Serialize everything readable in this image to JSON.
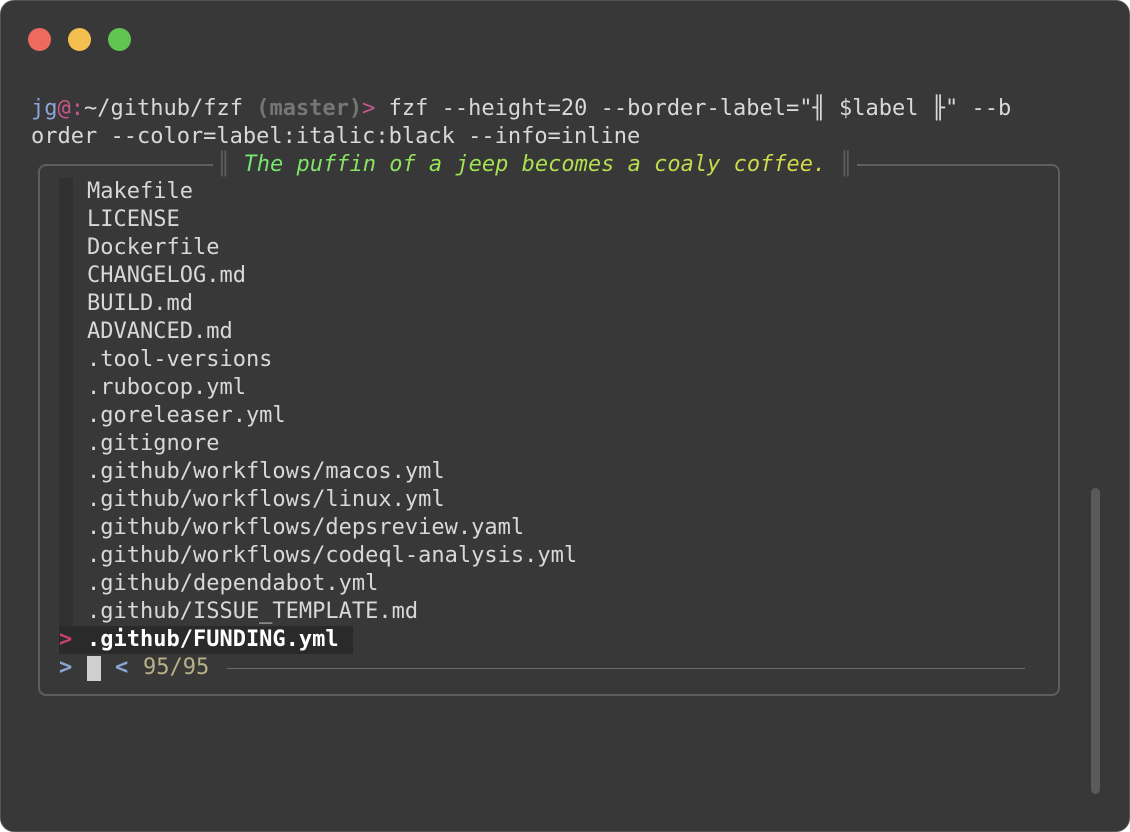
{
  "window": {
    "traffic_lights": {
      "close_color": "#ed6a5e",
      "minimize_color": "#f5bf4f",
      "maximize_color": "#61c554"
    }
  },
  "prompt": {
    "user": "jg",
    "at": "@",
    "colon": ":",
    "path": "~/github/fzf",
    "branch": "(master)",
    "arrow": ">",
    "command_line1": " fzf --height=20 --border-label=\"╢ $label ╟\" --b",
    "command_line2": "order --color=label:italic:black --info=inline"
  },
  "fzf": {
    "border_label": {
      "left_bar": "║",
      "text": "The puffin of a jeep becomes a coaly coffee.",
      "right_bar": "║"
    },
    "items": [
      "Makefile",
      "LICENSE",
      "Dockerfile",
      "CHANGELOG.md",
      "BUILD.md",
      "ADVANCED.md",
      ".tool-versions",
      ".rubocop.yml",
      ".goreleaser.yml",
      ".gitignore",
      ".github/workflows/macos.yml",
      ".github/workflows/linux.yml",
      ".github/workflows/depsreview.yaml",
      ".github/workflows/codeql-analysis.yml",
      ".github/dependabot.yml",
      ".github/ISSUE_TEMPLATE.md"
    ],
    "current_item": ".github/FUNDING.yml",
    "pointer": ">",
    "query_prompt": ">",
    "query_value": "",
    "info_separator": "<",
    "match_count": "95/95"
  }
}
